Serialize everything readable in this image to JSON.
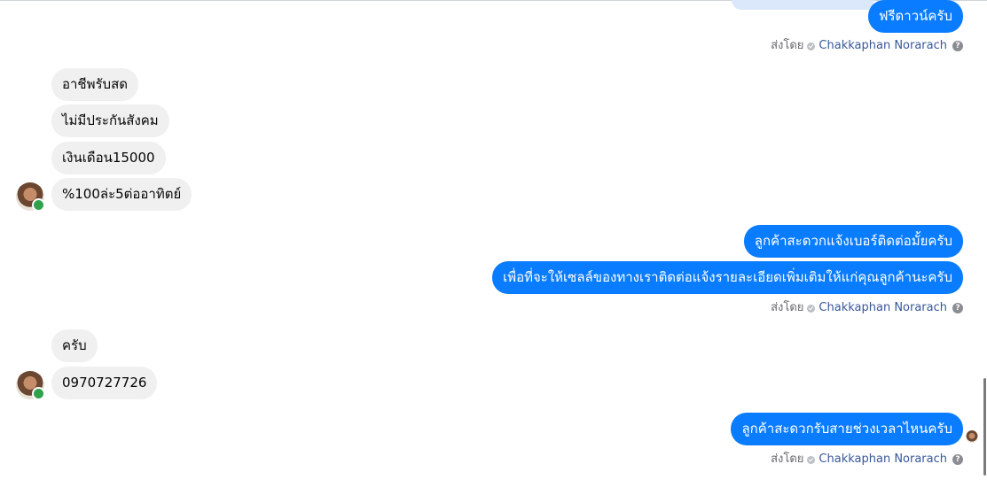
{
  "messages": {
    "out_top": "ฟรีดาวน์ครับ",
    "in_group1": [
      "อาชีพรับสด",
      "ไม่มีประกันสังคม",
      "เงินเดือน15000",
      "%100ล่ะ5ต่ออาทิตย์"
    ],
    "out_group2": [
      "ลูกค้าสะดวกแจ้งเบอร์ติดต่อมั้ยครับ",
      "เพื่อที่จะให้เซลล์ของทางเราติดต่อแจ้งรายละเอียดเพิ่มเติมให้แก่คุณลูกค้านะครับ"
    ],
    "in_group2": [
      "ครับ",
      "0970727726"
    ],
    "out_group3": "ลูกค้าสะดวกรับสายช่วงเวลาไหนครับ"
  },
  "meta": {
    "sent_by": "ส่งโดย",
    "sender": "Chakkaphan Norarach",
    "help": "?"
  },
  "icons": {
    "verified": "check-dot-icon",
    "help": "question-icon"
  },
  "colors": {
    "outgoing_bubble": "#0a7cff",
    "incoming_bubble": "#f0f0f0",
    "sender_link": "#385898"
  }
}
